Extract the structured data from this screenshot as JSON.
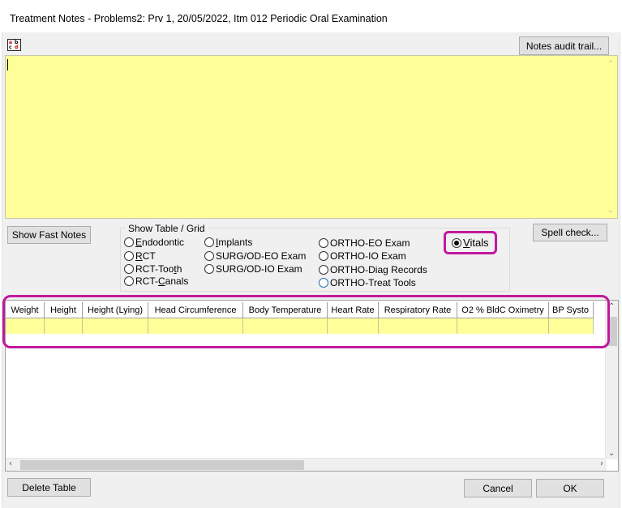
{
  "window": {
    "title": "Treatment Notes - Problems2: Prv 1, 20/05/2022, Itm 012 Periodic Oral Examination"
  },
  "toolbar": {
    "spell_icon": "abc-spell-icon",
    "notes_audit_label": "Notes audit trail..."
  },
  "notes": {
    "value": ""
  },
  "buttons": {
    "show_fast_notes": "Show Fast Notes",
    "spell_check": "Spell check...",
    "delete_table": "Delete Table",
    "cancel": "Cancel",
    "ok": "OK"
  },
  "table_group": {
    "legend": "Show Table / Grid",
    "options": [
      {
        "pre": "",
        "ul": "E",
        "post": "ndodontic"
      },
      {
        "pre": "",
        "ul": "R",
        "post": "CT"
      },
      {
        "pre": "RCT-Too",
        "ul": "t",
        "post": "h"
      },
      {
        "pre": "RCT-",
        "ul": "C",
        "post": "anals"
      },
      {
        "pre": "",
        "ul": "I",
        "post": "mplants"
      },
      {
        "pre": "SURG/OD-EO Exam",
        "ul": "",
        "post": ""
      },
      {
        "pre": "SURG/OD-IO Exam",
        "ul": "",
        "post": ""
      },
      {
        "pre": "ORTHO-EO Exam",
        "ul": "",
        "post": ""
      },
      {
        "pre": "ORTHO-IO Exam",
        "ul": "",
        "post": ""
      },
      {
        "pre": "ORTHO-Diag Records",
        "ul": "",
        "post": ""
      },
      {
        "pre": "ORTHO-Treat Tools",
        "ul": "",
        "post": ""
      }
    ],
    "vitals": {
      "pre": "",
      "ul": "V",
      "post": "itals",
      "selected": true
    }
  },
  "grid": {
    "columns": [
      "Weight",
      "Height",
      "Height (Lying)",
      "Head Circumference",
      "Body Temperature",
      "Heart Rate",
      "Respiratory Rate",
      "O2 % BldC Oximetry",
      "BP Systo"
    ],
    "row": [
      "",
      "",
      "",
      "",
      "",
      "",
      "",
      "",
      ""
    ]
  },
  "colors": {
    "highlight": "#c2189e",
    "note_bg": "#ffff99"
  }
}
